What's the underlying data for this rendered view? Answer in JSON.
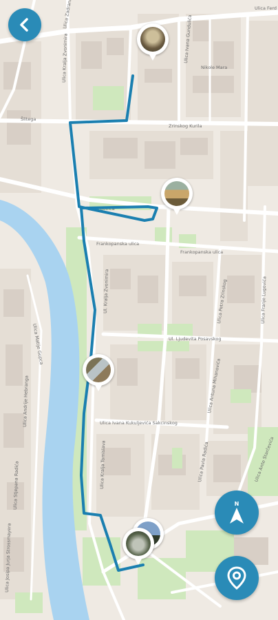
{
  "map": {
    "colors": {
      "land": "#efeae3",
      "block": "#e2dcd3",
      "building": "#d9d0c8",
      "road": "#ffffff",
      "river": "#a9d3f0",
      "park": "#cfe8bd",
      "route": "#1a7fb0",
      "button": "#2a8bb7"
    },
    "street_labels": [
      "Ulica Ferd",
      "Ulica Ivana Gundulića",
      "Nikole Mara",
      "Ulica Zadrana",
      "Šlitega",
      "Ulica Kralja Zvonimira",
      "Hrgovića",
      "Zrinskog Kurila",
      "Frankopanska ulica",
      "Ul. Kralja Zvonimira",
      "Frankopanska ulica",
      "Ulica Petra Zrinskog",
      "Ulica Franje Lugovića",
      "Ul. Ljudevita Posavskog",
      "Ulica Antuna Mihanovića",
      "Ulica Matije Gupca",
      "Ulica Andrije Hebranga",
      "Ulica Ivana Kukuljevića Sakcinskog",
      "Ulica Stjepana Radića",
      "Ulica Kralja Tomislava",
      "Ulica Pavla Radića",
      "Ulica Ante Starčevića",
      "Ulica Josipa Jurja Strossmayera"
    ]
  },
  "controls": {
    "back_icon": "chevron-left-icon",
    "compass_icon": "navigation-arrow-icon",
    "locate_icon": "location-pin-icon"
  },
  "markers": [
    {
      "name": "photo-marker-1",
      "icon": "photo-thumbnail"
    },
    {
      "name": "photo-marker-2",
      "icon": "photo-thumbnail"
    },
    {
      "name": "photo-marker-3",
      "icon": "photo-thumbnail"
    },
    {
      "name": "photo-marker-4",
      "icon": "photo-thumbnail"
    },
    {
      "name": "photo-marker-5",
      "icon": "photo-thumbnail"
    }
  ]
}
